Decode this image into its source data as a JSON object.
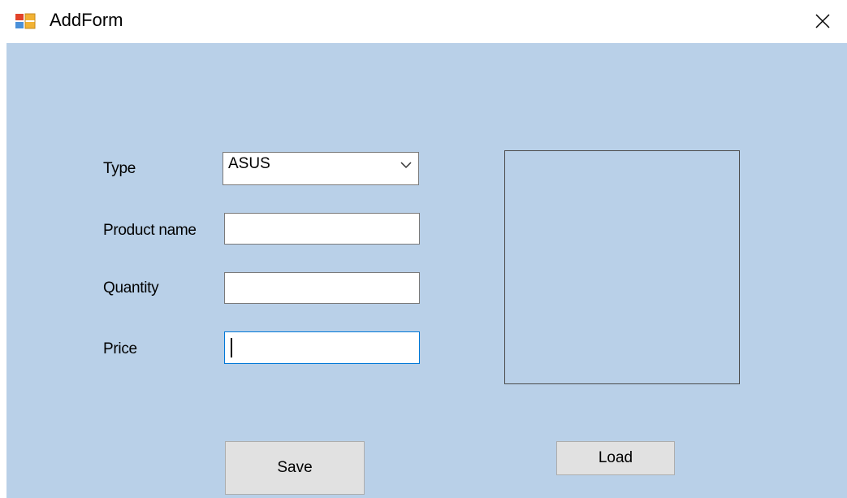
{
  "window": {
    "title": "AddForm",
    "icon": "form-app-icon",
    "close_glyph": "✕"
  },
  "form": {
    "type_label": "Type",
    "type_value": "ASUS",
    "product_name_label": "Product name",
    "product_name_value": "",
    "quantity_label": "Quantity",
    "quantity_value": "",
    "price_label": "Price",
    "price_value": ""
  },
  "buttons": {
    "save_label": "Save",
    "load_label": "Load"
  },
  "colors": {
    "client_background": "#b9d0e8",
    "focus_border": "#0078d7",
    "button_face": "#e1e1e1"
  }
}
